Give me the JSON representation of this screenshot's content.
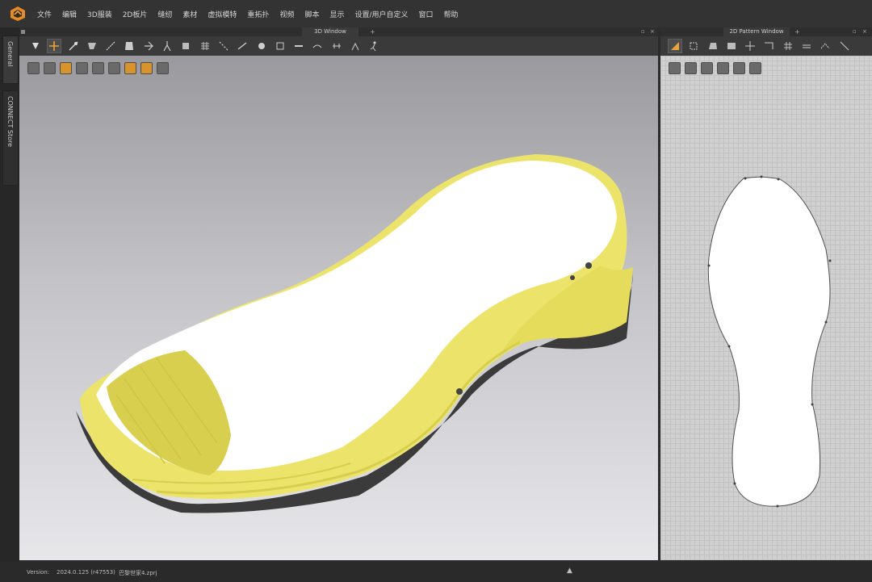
{
  "menu": [
    "文件",
    "编辑",
    "3D服装",
    "2D板片",
    "缝纫",
    "素材",
    "虚拟模特",
    "重拓扑",
    "视频",
    "脚本",
    "显示",
    "设置/用户自定义",
    "窗口",
    "帮助"
  ],
  "side_tabs": {
    "general": "General",
    "store": "CONNECT Store"
  },
  "window3d": {
    "title": "3D Window",
    "plus": "+",
    "dock": "▫",
    "close": "×"
  },
  "window2d": {
    "title": "2D Pattern Window",
    "plus": "+",
    "dock": "▫",
    "close": "×"
  },
  "status": {
    "version_label": "Version:",
    "version": "2024.0.125 (r47553)",
    "file": "巴黎世家4.zprj",
    "arrow": "▲"
  },
  "colors": {
    "accent": "#e9a23b",
    "sole_yellow": "#ece46a",
    "insole_white": "#ffffff",
    "bg_dark": "#333333"
  }
}
